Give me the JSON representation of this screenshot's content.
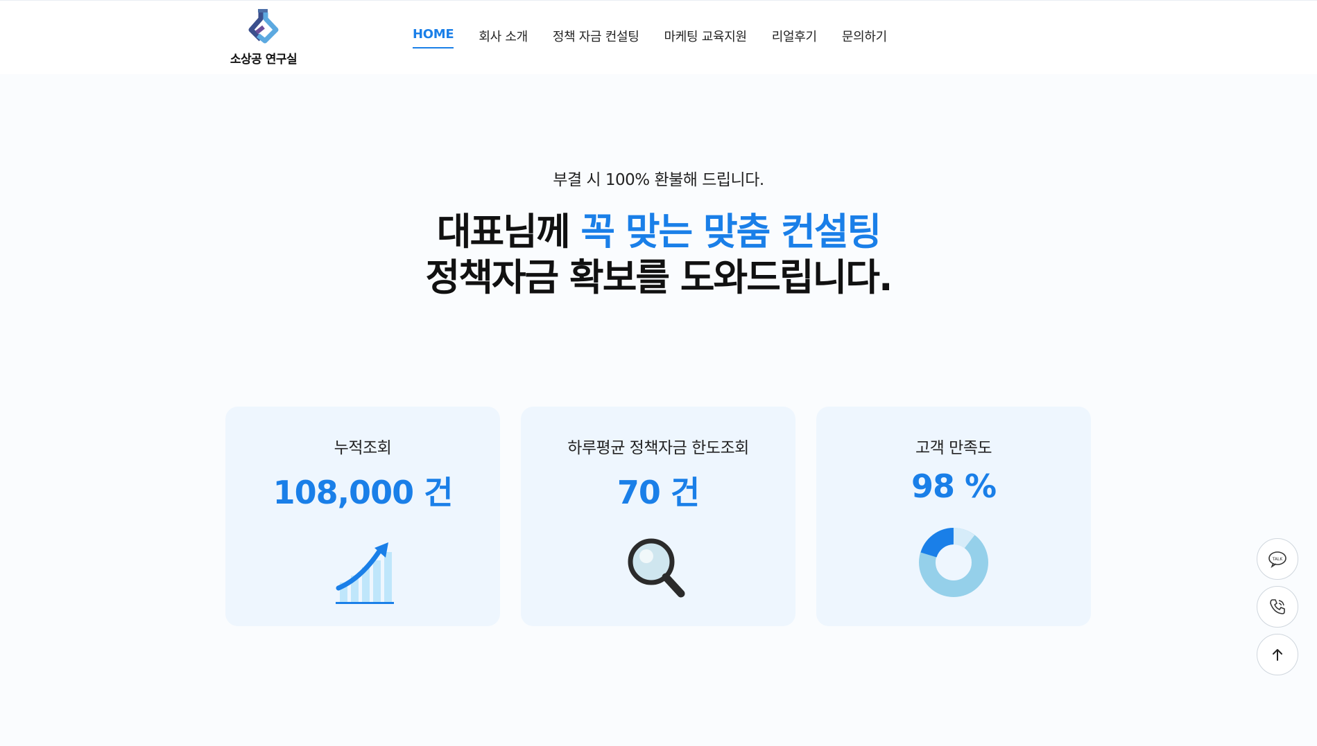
{
  "brand": {
    "name": "소상공 연구실",
    "colors": {
      "accent": "#1a7fe8",
      "card_bg": "#eef6fe",
      "text": "#111111"
    }
  },
  "nav": {
    "items": [
      {
        "label": "HOME",
        "active": true
      },
      {
        "label": "회사 소개"
      },
      {
        "label": "정책 자금 컨설팅"
      },
      {
        "label": "마케팅 교육지원"
      },
      {
        "label": "리얼후기"
      },
      {
        "label": "문의하기"
      }
    ]
  },
  "hero": {
    "subtitle": "부결 시 100% 환불해 드립니다.",
    "line1_prefix": "대표님께 ",
    "line1_accent": "꼭 맞는 맞춤 컨설팅",
    "line2": "정책자금 확보를 도와드립니다."
  },
  "stats": [
    {
      "label": "누적조회",
      "value": "108,000 건",
      "icon": "growth-chart-icon"
    },
    {
      "label": "하루평균 정책자금 한도조회",
      "value": "70 건",
      "icon": "magnifier-icon"
    },
    {
      "label": "고객 만족도",
      "value": "98 %",
      "icon": "donut-chart-icon",
      "level_percent": 98
    }
  ],
  "floating": {
    "talk_label": "TALK",
    "talk_icon": "kakao-talk-icon",
    "call_icon": "phone-icon",
    "top_icon": "arrow-up-icon"
  }
}
